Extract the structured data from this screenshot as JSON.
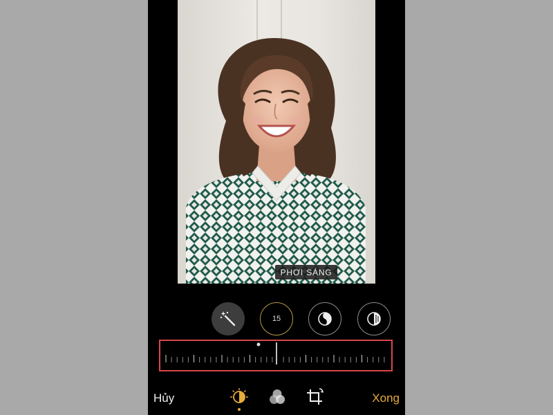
{
  "photo": {
    "alt": "Portrait photo of a smiling woman"
  },
  "adjustment": {
    "label": "PHƠI SÁNG",
    "value": "15"
  },
  "toolbar": {
    "cancel_label": "Hủy",
    "done_label": "Xong"
  },
  "colors": {
    "accent": "#e8ab3c",
    "highlight_box": "#d9474b",
    "value_ring": "#b79b4a"
  },
  "icons": [
    "magic-wand-icon",
    "brilliance-icon",
    "highlights-icon",
    "adjust-icon",
    "filters-icon",
    "crop-icon"
  ]
}
